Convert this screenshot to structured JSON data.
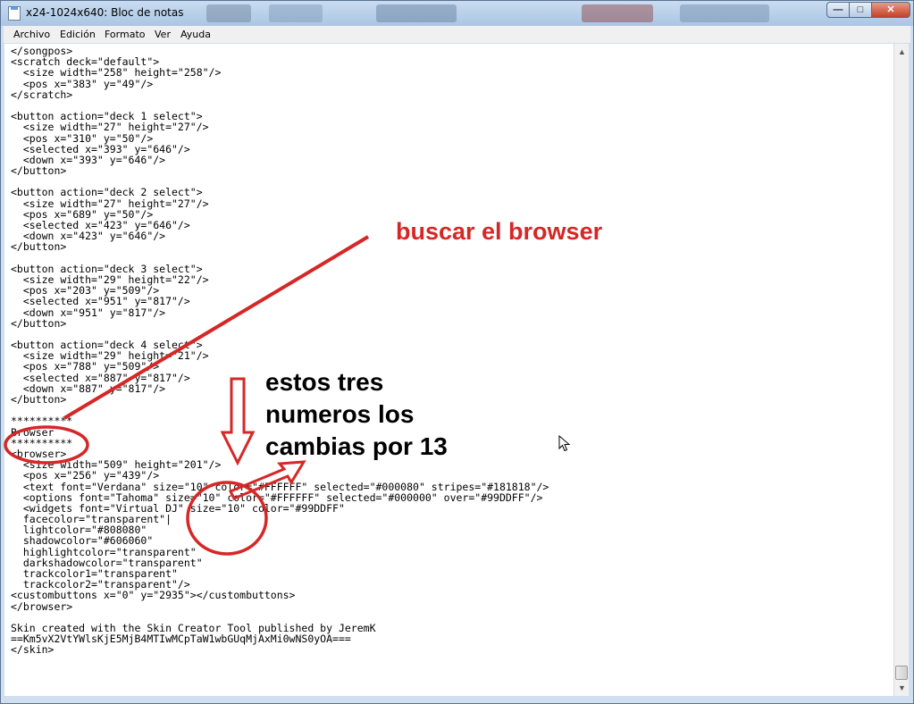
{
  "window": {
    "title": "x24-1024x640: Bloc de notas"
  },
  "menu": {
    "items": [
      "Archivo",
      "Edición",
      "Formato",
      "Ver",
      "Ayuda"
    ]
  },
  "editor": {
    "lines": [
      "</songpos>",
      "<scratch deck=\"default\">",
      "  <size width=\"258\" height=\"258\"/>",
      "  <pos x=\"383\" y=\"49\"/>",
      "</scratch>",
      "",
      "<button action=\"deck 1 select\">",
      "  <size width=\"27\" height=\"27\"/>",
      "  <pos x=\"310\" y=\"50\"/>",
      "  <selected x=\"393\" y=\"646\"/>",
      "  <down x=\"393\" y=\"646\"/>",
      "</button>",
      "",
      "<button action=\"deck 2 select\">",
      "  <size width=\"27\" height=\"27\"/>",
      "  <pos x=\"689\" y=\"50\"/>",
      "  <selected x=\"423\" y=\"646\"/>",
      "  <down x=\"423\" y=\"646\"/>",
      "</button>",
      "",
      "<button action=\"deck 3 select\">",
      "  <size width=\"29\" height=\"22\"/>",
      "  <pos x=\"203\" y=\"509\"/>",
      "  <selected x=\"951\" y=\"817\"/>",
      "  <down x=\"951\" y=\"817\"/>",
      "</button>",
      "",
      "<button action=\"deck 4 select\">",
      "  <size width=\"29\" height=\"21\"/>",
      "  <pos x=\"788\" y=\"509\"/>",
      "  <selected x=\"887\" y=\"817\"/>",
      "  <down x=\"887\" y=\"817\"/>",
      "</button>",
      "",
      "**********",
      "Browser",
      "**********",
      "<browser>",
      "  <size width=\"509\" height=\"201\"/>",
      "  <pos x=\"256\" y=\"439\"/>",
      "  <text font=\"Verdana\" size=\"10\" color=\"#FFFFFF\" selected=\"#000080\" stripes=\"#181818\"/>",
      "  <options font=\"Tahoma\" size=\"10\" color=\"#FFFFFF\" selected=\"#000000\" over=\"#99DDFF\"/>",
      "  <widgets font=\"Virtual DJ\" size=\"10\" color=\"#99DDFF\"",
      "  facecolor=\"transparent\"|",
      "  lightcolor=\"#808080\"",
      "  shadowcolor=\"#606060\"",
      "  highlightcolor=\"transparent\"",
      "  darkshadowcolor=\"transparent\"",
      "  trackcolor1=\"transparent\"",
      "  trackcolor2=\"transparent\"/>",
      "<custombuttons x=\"0\" y=\"2935\"></custombuttons>",
      "</browser>",
      "",
      "Skin created with the Skin Creator Tool published by JeremK",
      "==Km5vX2VtYWlsKjE5MjB4MTIwMCpTaW1wbGUqMjAxMi0wNS0yOA===",
      "</skin>"
    ]
  },
  "annotations": {
    "red_note": "buscar el browser",
    "black_note": [
      "estos tres",
      "numeros los",
      "cambias por 13"
    ]
  },
  "colors": {
    "annotation_red": "#d62727",
    "titlebar": "#b9d1ec",
    "close_button": "#c4412a"
  },
  "icons": {
    "title": "notepad-icon",
    "minimize": "minimize-icon",
    "maximize": "maximize-icon",
    "close": "close-icon",
    "cursor": "mouse-pointer-icon"
  }
}
